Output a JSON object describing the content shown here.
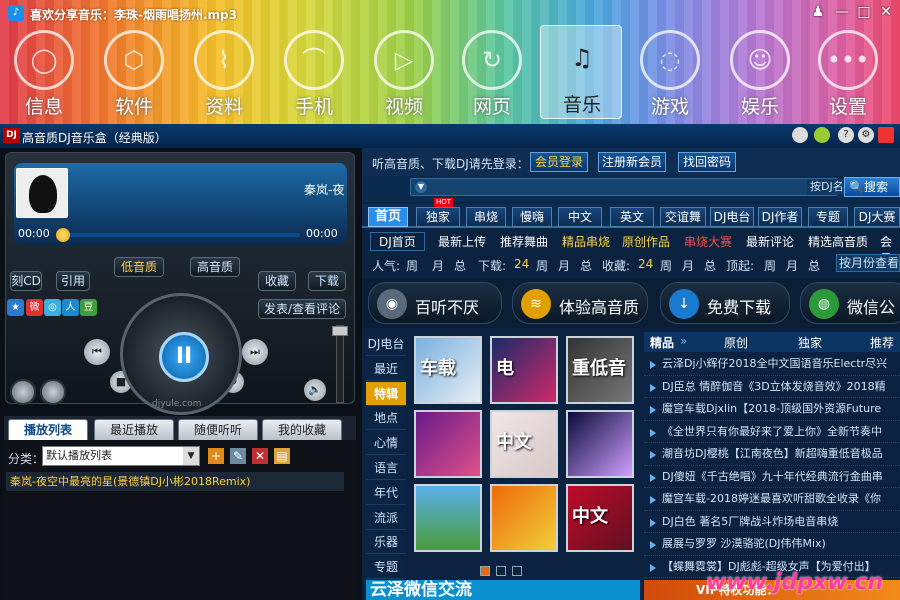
{
  "window": {
    "title": "喜欢分享音乐：李珠-烟雨唱扬州.mp3",
    "controls": [
      "♟",
      "—",
      "□",
      "✕"
    ]
  },
  "nav": [
    {
      "label": "信息",
      "icon": "person-icon",
      "glyph": "◯"
    },
    {
      "label": "软件",
      "icon": "box-icon",
      "glyph": "⬡"
    },
    {
      "label": "资料",
      "icon": "document-icon",
      "glyph": "⌇"
    },
    {
      "label": "手机",
      "icon": "phone-icon",
      "glyph": "⌒"
    },
    {
      "label": "视频",
      "icon": "play-icon",
      "glyph": "▷"
    },
    {
      "label": "网页",
      "icon": "refresh-icon",
      "glyph": "↻"
    },
    {
      "label": "音乐",
      "icon": "music-icon",
      "glyph": "♫"
    },
    {
      "label": "游戏",
      "icon": "game-icon",
      "glyph": "◌"
    },
    {
      "label": "娱乐",
      "icon": "mask-icon",
      "glyph": "☺"
    },
    {
      "label": "设置",
      "icon": "more-icon",
      "glyph": "•••"
    }
  ],
  "dj": {
    "logo": "DJ",
    "title": "高音质DJ音乐盒（经典版）"
  },
  "player": {
    "song_short": "秦岚-夜空",
    "time_left": "00:00",
    "time_right": "00:00",
    "progress": 0.0,
    "btn_cd": "刻CD",
    "btn_ref": "引用",
    "btn_low": "低音质",
    "btn_high": "高音质",
    "btn_fav": "收藏",
    "btn_dl": "下载",
    "btn_comment": "发表/查看评论",
    "site": "djyule.com",
    "pause": "II",
    "prev": "⏮",
    "next": "⏭",
    "stop": "■",
    "repeat": "↻",
    "volume": "🔊"
  },
  "tabs": [
    "播放列表",
    "最近播放",
    "随便听听",
    "我的收藏"
  ],
  "playlist": {
    "cat_label": "分类：",
    "cat_value": "默认播放列表",
    "item": "秦岚-夜空中最亮的星(景德镇DJ小彬2018Remix)"
  },
  "login": {
    "tip": "听高音质、下载DJ请先登录：",
    "member": "会员登录",
    "register": "注册新会员",
    "recover": "找回密码"
  },
  "search": {
    "dropdown": "按DJ名称",
    "button": "搜索"
  },
  "cats": [
    "首页",
    "独家",
    "串烧",
    "慢嗨",
    "中文",
    "英文",
    "交谊舞",
    "DJ电台",
    "DJ作者",
    "专题",
    "DJ大赛"
  ],
  "hot": "HOT",
  "subnav": [
    {
      "t": "DJ首页",
      "c": ""
    },
    {
      "t": "最新上传",
      "c": ""
    },
    {
      "t": "推荐舞曲",
      "c": ""
    },
    {
      "t": "精品串烧",
      "c": "yel"
    },
    {
      "t": "原创作品",
      "c": "yel"
    },
    {
      "t": "串烧大赛",
      "c": "red"
    },
    {
      "t": "最新评论",
      "c": ""
    },
    {
      "t": "精选高音质",
      "c": ""
    },
    {
      "t": "会员",
      "c": ""
    }
  ],
  "rank": [
    {
      "t": "人气:",
      "n": false
    },
    {
      "t": "周",
      "n": false
    },
    {
      "t": "月",
      "n": false
    },
    {
      "t": "总",
      "n": false
    },
    {
      "t": "下载:",
      "n": false
    },
    {
      "t": "24",
      "n": true
    },
    {
      "t": "周",
      "n": false
    },
    {
      "t": "月",
      "n": false
    },
    {
      "t": "总",
      "n": false
    },
    {
      "t": "收藏:",
      "n": false
    },
    {
      "t": "24",
      "n": true
    },
    {
      "t": "周",
      "n": false
    },
    {
      "t": "月",
      "n": false
    },
    {
      "t": "总",
      "n": false
    },
    {
      "t": "顶起:",
      "n": false
    },
    {
      "t": "周",
      "n": false
    },
    {
      "t": "月",
      "n": false
    },
    {
      "t": "总",
      "n": false
    }
  ],
  "rank_button": "按月份查看",
  "features": [
    {
      "label": "百听不厌",
      "icon": "disc-icon",
      "color": "#5a6a7a"
    },
    {
      "label": "体验高音质",
      "icon": "wave-icon",
      "color": "#e0a000"
    },
    {
      "label": "免费下载",
      "icon": "download-icon",
      "color": "#1a7ad0"
    },
    {
      "label": "微信公",
      "icon": "wechat-icon",
      "color": "#2a9a3a"
    }
  ],
  "djcats": [
    "DJ电台",
    "最近",
    "特辑",
    "地点",
    "心情",
    "语言",
    "年代",
    "流派",
    "乐器",
    "专题"
  ],
  "tiles": [
    {
      "label": "车载",
      "bg": "linear-gradient(135deg,#7ab0e0,#e8eef4)"
    },
    {
      "label": "电",
      "bg": "linear-gradient(135deg,#1a2a6a,#d02a6a)"
    },
    {
      "label": "重低音",
      "bg": "linear-gradient(135deg,#333,#777)"
    },
    {
      "label": "",
      "bg": "linear-gradient(135deg,#6a1a8a,#e0508a)"
    },
    {
      "label": "中文",
      "bg": "linear-gradient(135deg,#f2e6e6,#d8c8c8)"
    },
    {
      "label": "",
      "bg": "linear-gradient(135deg,#0a0a3a,#d0a0ff)"
    },
    {
      "label": "",
      "bg": "linear-gradient(#5ab0ea,#4a9a3a)"
    },
    {
      "label": "",
      "bg": "linear-gradient(135deg,#f06a0a,#f0d03a)"
    },
    {
      "label": "中文",
      "bg": "linear-gradient(135deg,#c00a2a,#601020)"
    }
  ],
  "list_head": {
    "a": "精品",
    "b": "原创",
    "c": "独家",
    "d": "推荐"
  },
  "list": [
    "云泽Dj小辉仔2018全中文国语音乐Electr尽兴",
    "DJ臣总 情醉伽音《3D立体发烧音效》2018精",
    "魔宫车载Djxlin【2018-顶级国外资源Future",
    "《全世界只有你最好来了爱上你》全新节奏中",
    "潮音坊DJ樱桃【江南夜色】新超嗨重低音极品",
    "DJ傻妞《千古绝唱》九十年代经典流行金曲串",
    "魔宫车载-2018婷迷最喜欢听甜歌全收录《你",
    "DJ白色 著名5厂牌战斗炸场电音串烧",
    "展展与罗罗 沙漠骆驼(DJ伟伟Mix)",
    "【蝶舞霓裳】DJ彪彪-超级女声【为爱付出】"
  ],
  "vip": "VIP特权功能：",
  "banner": "云泽微信交流",
  "watermark": "www.jdpxw.cn"
}
